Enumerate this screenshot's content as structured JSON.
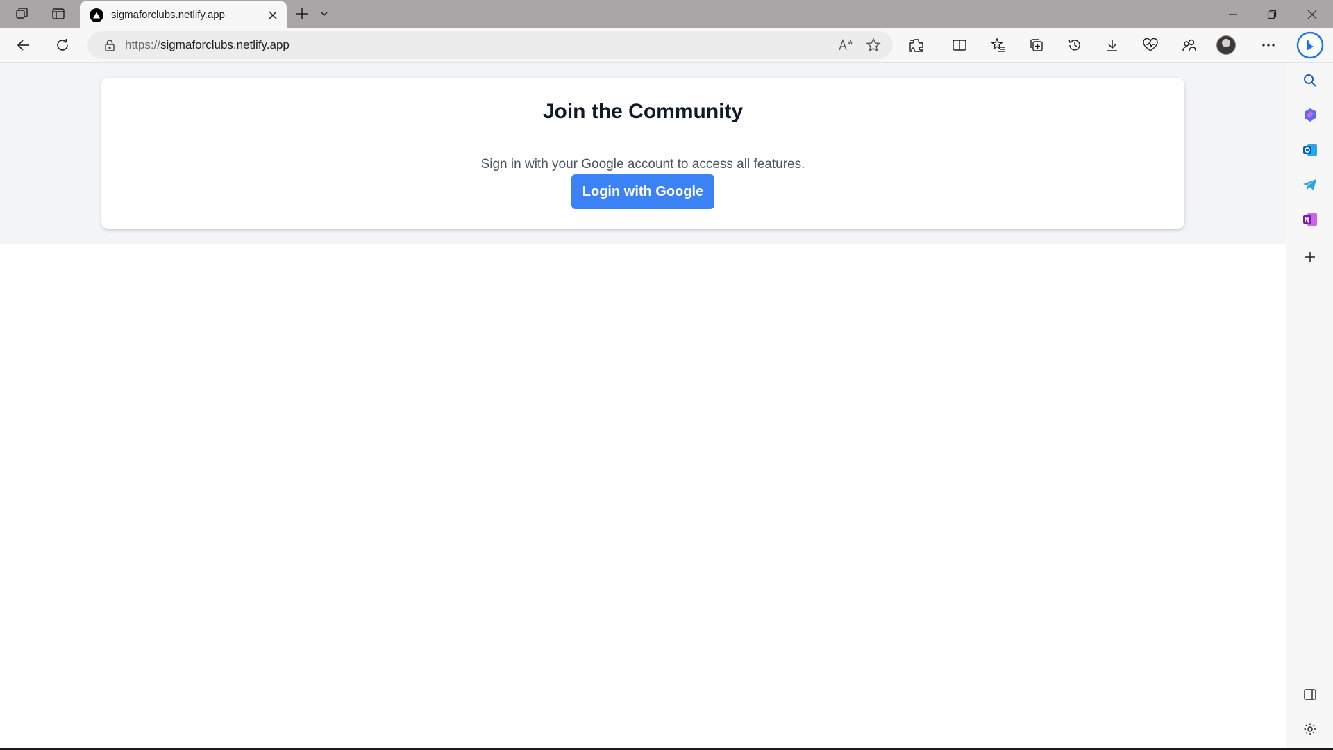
{
  "browser": {
    "tab": {
      "title": "sigmaforclubs.netlify.app",
      "favicon": "triangle-logo-icon"
    },
    "address": {
      "scheme": "https://",
      "host": "sigmaforclubs.netlify.app"
    },
    "titlebar_icons": [
      "workspaces-icon",
      "vertical-tabs-icon",
      "new-tab-icon",
      "tab-list-chevron-icon"
    ],
    "window_controls": [
      "minimize-icon",
      "restore-icon",
      "close-icon"
    ],
    "toolbar_icons": [
      "back-icon",
      "refresh-icon",
      "read-aloud-icon",
      "favorite-star-icon",
      "extensions-icon",
      "split-screen-icon",
      "favorites-icon",
      "collections-icon",
      "history-icon",
      "downloads-icon",
      "browser-essentials-icon",
      "copilot-share-icon",
      "profile-avatar",
      "more-menu-icon"
    ],
    "sidebar_icons": [
      "bing-icon",
      "search-icon",
      "copilot-icon",
      "outlook-icon",
      "telegram-icon",
      "onenote-icon",
      "add-icon",
      "hide-sidebar-icon",
      "settings-icon"
    ]
  },
  "page": {
    "title": "Join the Community",
    "subtitle": "Sign in with your Google account to access all features.",
    "login_button": "Login with Google"
  },
  "colors": {
    "accent": "#3b82f6",
    "band_background": "#f3f4f6",
    "card_background": "#ffffff",
    "title_text": "#111827",
    "subtitle_text": "#4b5563"
  }
}
